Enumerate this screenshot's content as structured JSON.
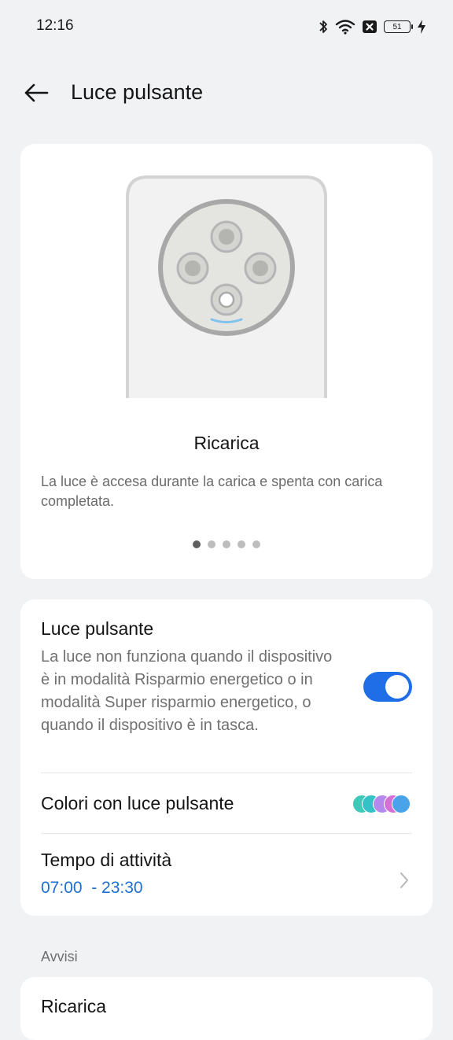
{
  "status_bar": {
    "time": "12:16",
    "battery_level": "51",
    "icons": [
      "bluetooth-icon",
      "wifi-icon",
      "notification-x-icon",
      "battery-icon",
      "charging-bolt-icon"
    ]
  },
  "header": {
    "back_icon": "arrow-left-icon",
    "title": "Luce pulsante"
  },
  "preview": {
    "title": "Ricarica",
    "description": "La luce è accesa durante la carica e spenta con carica completata.",
    "page_count": 5,
    "active_page": 1
  },
  "settings": {
    "pulse_light": {
      "title": "Luce pulsante",
      "description": "La luce non funziona quando il dispositivo è in modalità Risparmio energetico o in modalità Super risparmio energetico, o quando il dispositivo è in tasca.",
      "enabled": true
    },
    "colors": {
      "title": "Colori con luce pulsante",
      "chip_colors": [
        "#3fc9b8",
        "#35c2c6",
        "#b489ee",
        "#d46fd6",
        "#4aa3e8"
      ]
    },
    "active_time": {
      "title": "Tempo di attività",
      "value": "07:00  - 23:30"
    }
  },
  "notifications_section": {
    "label": "Avvisi",
    "first_item": "Ricarica"
  },
  "colors": {
    "accent": "#1f6ee8",
    "link": "#1d6fd1",
    "background": "#f1f2f4"
  }
}
